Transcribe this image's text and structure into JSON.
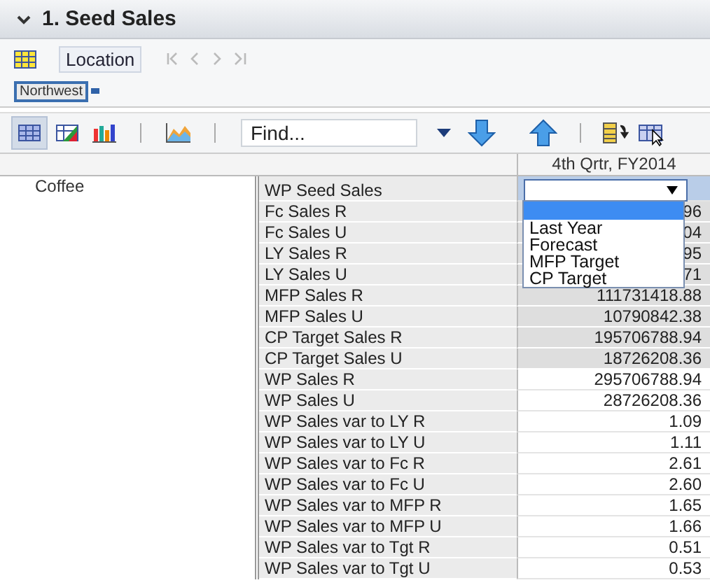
{
  "panel": {
    "title": "1. Seed Sales",
    "expanded": true
  },
  "dimension": {
    "button": "Location",
    "filter_tag": "Northwest"
  },
  "toolbar": {
    "find_placeholder": "Find..."
  },
  "table": {
    "column_header": "4th Qrtr, FY2014",
    "row_group": "Coffee",
    "first_row": {
      "label": "WP Seed Sales"
    },
    "rows": [
      {
        "label": "Fc Sales R",
        "value": "96",
        "shaded": true
      },
      {
        "label": "Fc Sales U",
        "value": "04",
        "shaded": true
      },
      {
        "label": "LY Sales R",
        "value": "95",
        "shaded": true
      },
      {
        "label": "LY Sales U",
        "value": "71",
        "shaded": true
      },
      {
        "label": "MFP Sales R",
        "value": "111731418.88",
        "shaded": true
      },
      {
        "label": "MFP Sales U",
        "value": "10790842.38",
        "shaded": true
      },
      {
        "label": "CP Target Sales R",
        "value": "195706788.94",
        "shaded": true
      },
      {
        "label": "CP Target Sales U",
        "value": "18726208.36",
        "shaded": true
      },
      {
        "label": "WP Sales R",
        "value": "295706788.94",
        "shaded": false
      },
      {
        "label": "WP Sales U",
        "value": "28726208.36",
        "shaded": false
      },
      {
        "label": "WP Sales var to LY R",
        "value": "1.09",
        "shaded": false
      },
      {
        "label": "WP Sales var to LY U",
        "value": "1.11",
        "shaded": false
      },
      {
        "label": "WP Sales var to Fc R",
        "value": "2.61",
        "shaded": false
      },
      {
        "label": "WP Sales var to Fc U",
        "value": "2.60",
        "shaded": false
      },
      {
        "label": "WP Sales var to MFP R",
        "value": "1.65",
        "shaded": false
      },
      {
        "label": "WP Sales var to MFP U",
        "value": "1.66",
        "shaded": false
      },
      {
        "label": "WP Sales var to Tgt R",
        "value": "0.51",
        "shaded": false
      },
      {
        "label": "WP Sales var to Tgt U",
        "value": "0.53",
        "shaded": false
      }
    ]
  },
  "dropdown": {
    "options": [
      "Last Year",
      "Forecast",
      "MFP Target",
      "CP Target"
    ]
  }
}
